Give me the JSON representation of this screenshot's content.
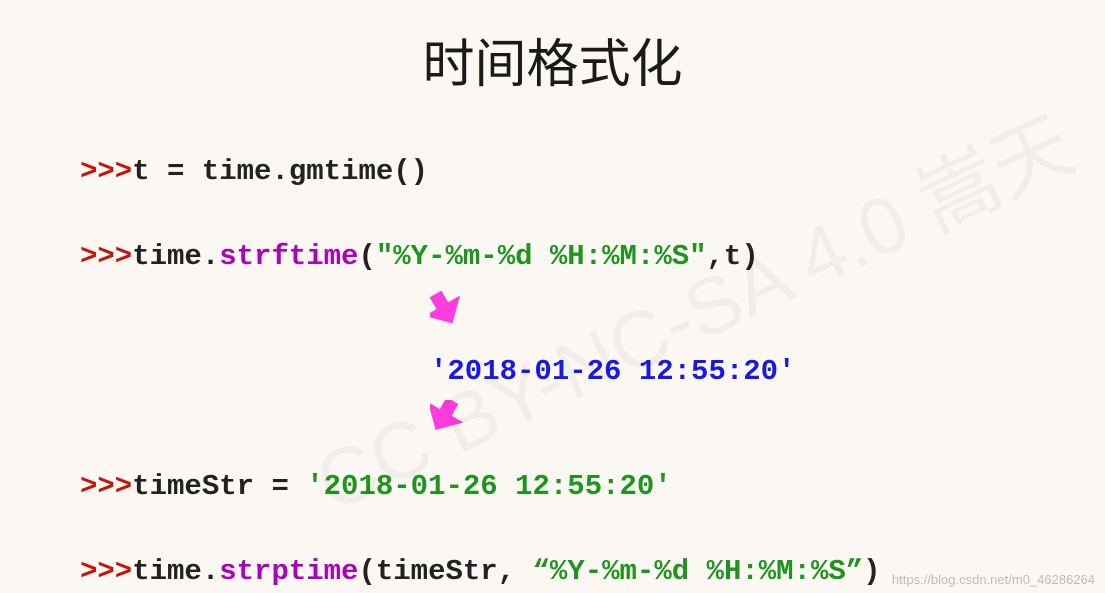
{
  "title": "时间格式化",
  "lines": {
    "l1": {
      "prompt": ">>>",
      "rest": "t = time.gmtime()"
    },
    "l2": {
      "prompt": ">>>",
      "part1": "time.",
      "func": "strftime",
      "paren_open": "(",
      "str": "\"%Y-%m-%d %H:%M:%S\"",
      "after": ",t)"
    },
    "l3": {
      "out": "'2018-01-26 12:55:20'"
    },
    "l4": {
      "prompt": ">>>",
      "part1": "timeStr = ",
      "str": "'2018-01-26 12:55:20'"
    },
    "l5": {
      "prompt": ">>>",
      "part1": "time.",
      "func": "strptime",
      "paren_open": "(",
      "mid": "timeStr, ",
      "str": "“%Y-%m-%d %H:%M:%S”",
      "after": ")"
    }
  },
  "watermark_main": "CC BY-NC-SA 4.0 嵩天",
  "watermark_small": "https://blog.csdn.net/m0_46286264",
  "arrow_color": "#ff3ce0"
}
